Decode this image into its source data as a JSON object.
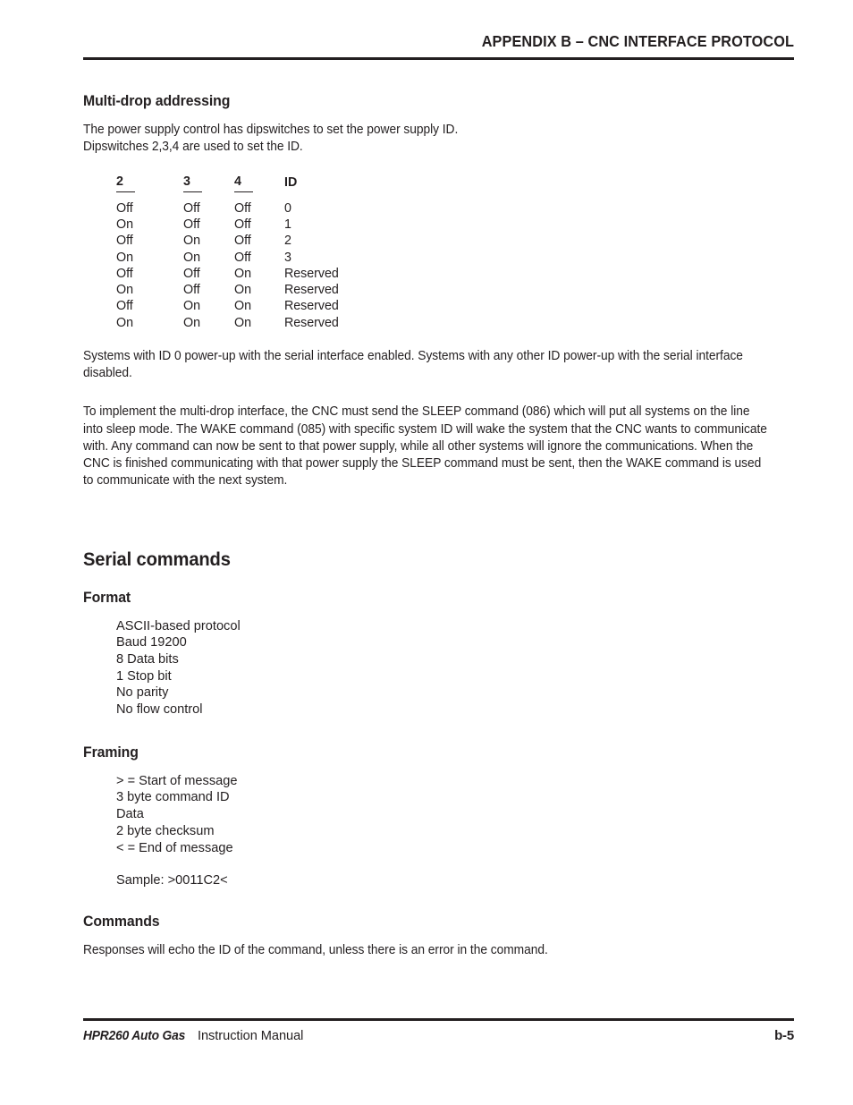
{
  "header": {
    "title": "APPENDIX B – CNC INTERFACE PROTOCOL"
  },
  "multidrop": {
    "heading": "Multi-drop addressing",
    "intro_line1": "The power supply control has dipswitches to set the power supply ID.",
    "intro_line2": "Dipswitches 2,3,4 are used to set the ID.",
    "table": {
      "headers": [
        "2",
        "3",
        "4",
        "ID"
      ],
      "rows": [
        [
          "Off",
          "Off",
          "Off",
          "0"
        ],
        [
          "On",
          "Off",
          "Off",
          "1"
        ],
        [
          "Off",
          "On",
          "Off",
          "2"
        ],
        [
          "On",
          "On",
          "Off",
          "3"
        ],
        [
          "Off",
          "Off",
          "On",
          "Reserved"
        ],
        [
          "On",
          "Off",
          "On",
          "Reserved"
        ],
        [
          "Off",
          "On",
          "On",
          "Reserved"
        ],
        [
          "On",
          "On",
          "On",
          "Reserved"
        ]
      ]
    },
    "paragraph1": "Systems with ID 0 power-up with the serial interface enabled. Systems with any other ID power-up with the serial interface disabled.",
    "paragraph2": "To implement the multi-drop interface, the CNC must send the SLEEP command (086) which will put all systems on the line into sleep mode. The WAKE command (085) with specific system ID will wake the system that the CNC wants to communicate with. Any command can now be sent to that power supply, while all other systems will ignore the communications. When the CNC is finished communicating with that power supply the SLEEP command must be sent, then the WAKE command is used to communicate with the next system."
  },
  "serial": {
    "heading": "Serial commands",
    "format": {
      "heading": "Format",
      "items": [
        "ASCII-based protocol",
        "Baud 19200",
        "8 Data bits",
        "1 Stop bit",
        "No parity",
        "No flow control"
      ]
    },
    "framing": {
      "heading": "Framing",
      "items": [
        "> = Start of message",
        "3 byte command ID",
        "Data",
        "2 byte checksum",
        "< = End of message"
      ],
      "sample": "Sample: >0011C2<"
    },
    "commands": {
      "heading": "Commands",
      "paragraph": "Responses will echo the ID of the command, unless there is an error in the command."
    }
  },
  "footer": {
    "product": "HPR260 Auto Gas",
    "manual": " Instruction Manual",
    "page": "b-5"
  },
  "colors": {
    "ink": "#231f20",
    "page": "#ffffff"
  }
}
